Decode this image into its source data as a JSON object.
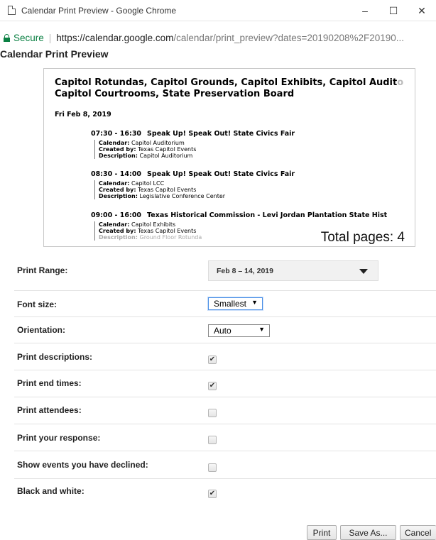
{
  "window": {
    "title": "Calendar Print Preview - Google Chrome",
    "minimize": "–",
    "maximize": "☐",
    "close": "✕"
  },
  "address": {
    "secure_label": "Secure",
    "separator": "|",
    "url_host": "https://calendar.google.com",
    "url_path": "/calendar/print_preview?dates=20190208%2F20190..."
  },
  "dialog": {
    "title": "Calendar Print Preview"
  },
  "preview": {
    "title_line1": "Capitol Rotundas, Capitol Grounds, Capitol Exhibits, Capitol Audit",
    "title_line1_fade": "o",
    "title_line2": "Capitol Courtrooms, State Preservation Board",
    "date": "Fri Feb 8, 2019",
    "events": [
      {
        "time": "07:30 - 16:30",
        "name": "Speak Up! Speak Out! State Civics Fair",
        "calendar_label": "Calendar:",
        "calendar": "Capitol Auditorium",
        "created_label": "Created by:",
        "created": "Texas Capitol Events",
        "desc_label": "Description:",
        "desc": "Capitol Auditorium"
      },
      {
        "time": "08:30 - 14:00",
        "name": "Speak Up! Speak Out! State Civics Fair",
        "calendar_label": "Calendar:",
        "calendar": "Capitol LCC",
        "created_label": "Created by:",
        "created": "Texas Capitol Events",
        "desc_label": "Description:",
        "desc": "Legislative Conference Center"
      },
      {
        "time": "09:00 - 16:00",
        "name": "Texas Historical Commission - Levi Jordan Plantation State Hist",
        "calendar_label": "Calendar:",
        "calendar": "Capitol Exhibits",
        "created_label": "Created by:",
        "created": "Texas Capitol Events",
        "desc_label": "Description:",
        "desc": "Ground Floor Rotunda"
      }
    ],
    "total_pages": "Total pages: 4"
  },
  "options": {
    "print_range": {
      "label": "Print Range:",
      "value": "Feb 8 – 14, 2019"
    },
    "font_size": {
      "label": "Font size:",
      "value": "Smallest"
    },
    "orientation": {
      "label": "Orientation:",
      "value": "Auto"
    },
    "print_descriptions": {
      "label": "Print descriptions:",
      "checked": true
    },
    "print_end_times": {
      "label": "Print end times:",
      "checked": true
    },
    "print_attendees": {
      "label": "Print attendees:",
      "checked": false
    },
    "print_response": {
      "label": "Print your response:",
      "checked": false
    },
    "show_declined": {
      "label": "Show events you have declined:",
      "checked": false
    },
    "black_white": {
      "label": "Black and white:",
      "checked": true
    },
    "checkmark": "✔",
    "dropdown_arrow": "▼"
  },
  "buttons": {
    "print": "Print",
    "save_as": "Save As...",
    "cancel": "Cancel"
  }
}
